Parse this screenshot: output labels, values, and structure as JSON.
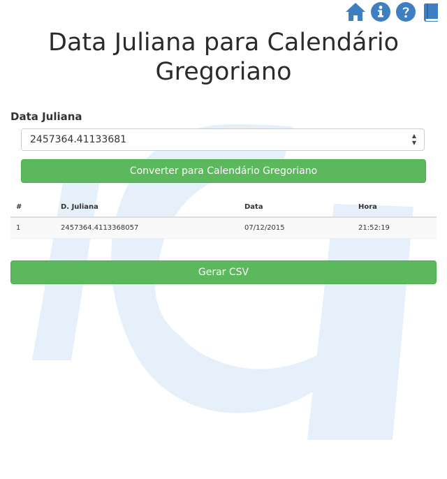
{
  "page": {
    "title": "Data Juliana para Calendário Gregoriano"
  },
  "nav": {
    "icons": [
      "home-icon",
      "info-icon",
      "question-icon",
      "book-icon"
    ],
    "color": "#3d7fc1"
  },
  "form": {
    "label": "Data Juliana",
    "value": "2457364.41133681",
    "convert_label": "Converter para Calendário Gregoriano"
  },
  "table": {
    "columns": [
      "#",
      "D. Juliana",
      "Data",
      "Hora"
    ],
    "rows": [
      [
        "1",
        "2457364.4113368057",
        "07/12/2015",
        "21:52:19"
      ]
    ]
  },
  "csv_label": "Gerar CSV",
  "colors": {
    "button": "#5cb85c",
    "watermark": "#e5f0fa"
  }
}
